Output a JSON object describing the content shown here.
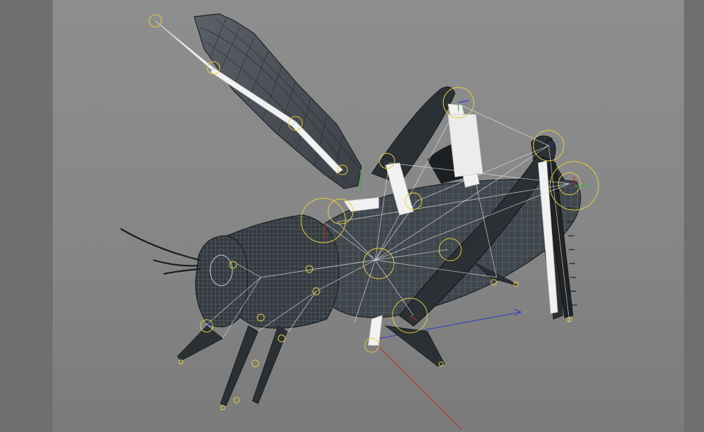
{
  "viewport": {
    "background_top": "#8e8e8e",
    "background_bottom": "#7b7b7b",
    "object": "grasshopper-rig",
    "joint_color": "#e6cf3a",
    "bone_color": "#f2f2f2",
    "mesh_color": "#3f464c",
    "axis_colors": {
      "x": "#c22a2a",
      "y": "#2fae3f",
      "z": "#2f38c8"
    }
  }
}
